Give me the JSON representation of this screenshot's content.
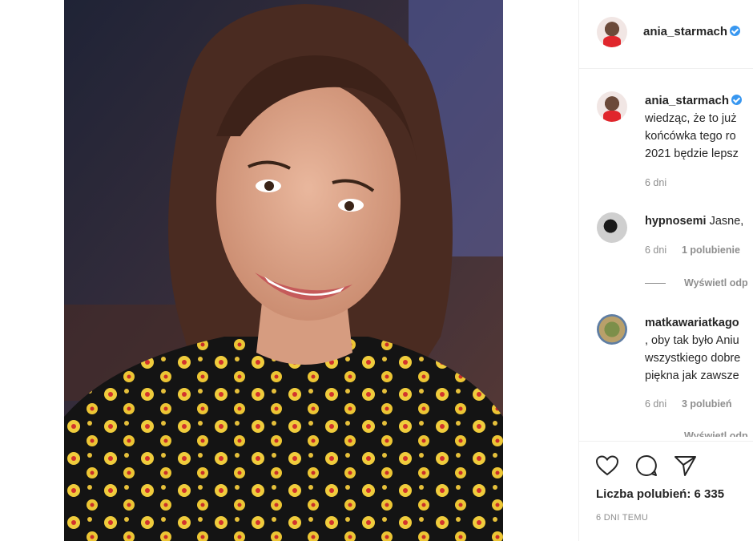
{
  "post": {
    "author": "ania_starmach",
    "caption_lines": [
      "wiedząc, że to już",
      "końcówka tego ro",
      "2021 będzie lepsz"
    ],
    "caption_age": "6 dni"
  },
  "comments": [
    {
      "username": "hypnosemi",
      "text_lines": [
        "Jasne,"
      ],
      "age": "6 dni",
      "likes": "1 polubienie",
      "replies_label": "Wyświetl odp"
    },
    {
      "username": "matkawariatkago",
      "text_lines": [
        ", oby tak było Aniu",
        "wszystkiego dobre",
        "piękna jak zawsze"
      ],
      "age": "6 dni",
      "likes": "3 polubień",
      "replies_label": "Wyświetl odp"
    }
  ],
  "likes_label": "Liczba polubień: 6 335",
  "posted": "6 DNI TEMU",
  "colors": {
    "verified": "#3897f0",
    "muted_text": "#8e8e8e",
    "divider": "#efefef"
  },
  "icons": [
    "heart-icon",
    "comment-icon",
    "share-icon",
    "verified-badge-icon"
  ]
}
